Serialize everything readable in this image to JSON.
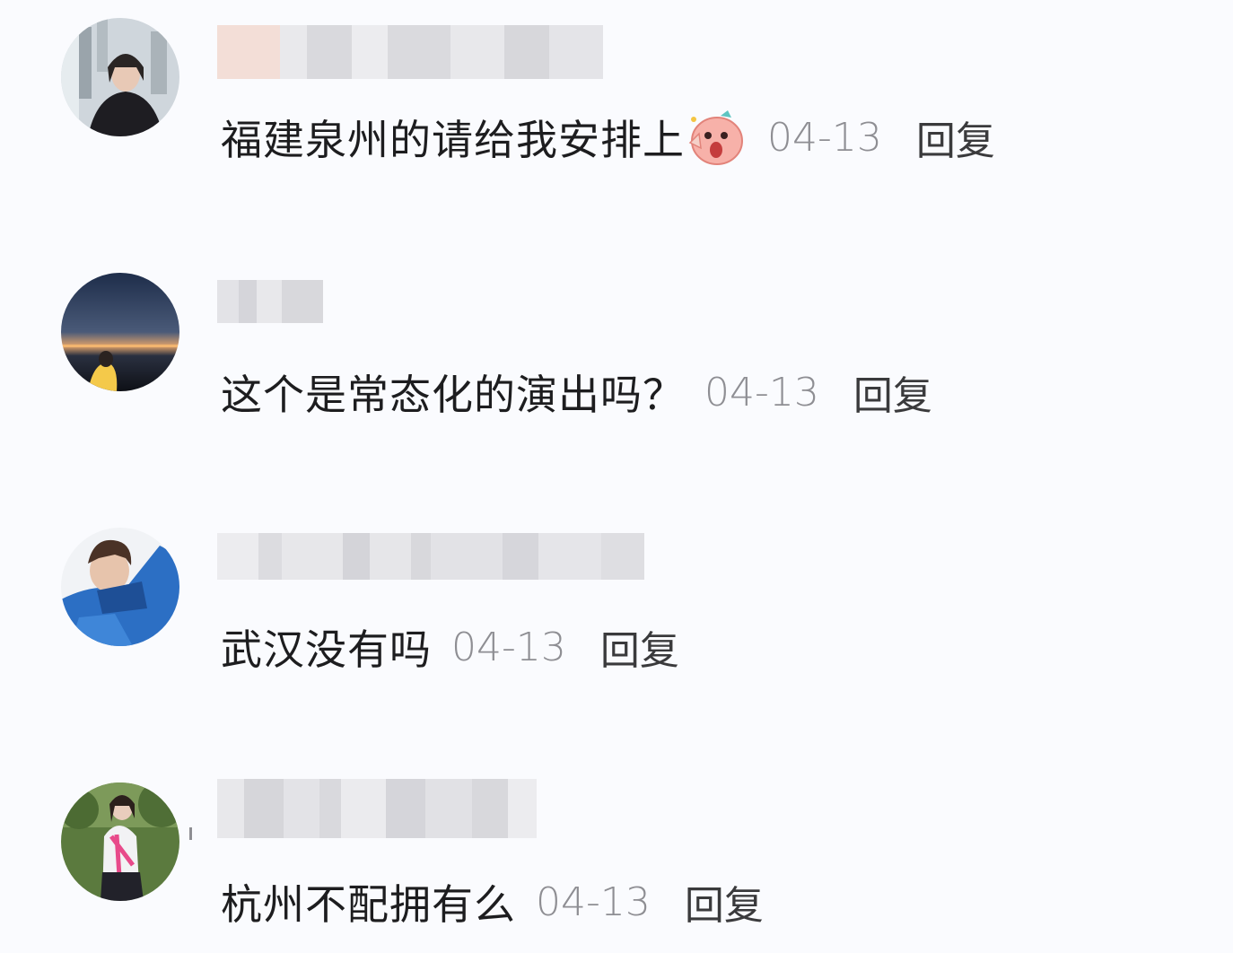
{
  "comments": [
    {
      "text": "福建泉州的请给我安排上",
      "emoji": "shocked-face-emoji",
      "date": "04-13",
      "reply": "回复"
    },
    {
      "text": "这个是常态化的演出吗？",
      "date": "04-13",
      "reply": "回复"
    },
    {
      "text": "武汉没有吗",
      "date": "04-13",
      "reply": "回复"
    },
    {
      "text": "杭州不配拥有么",
      "date": "04-13",
      "reply": "回复"
    }
  ],
  "colors": {
    "background": "#fafbfe",
    "text": "#1d1d1f",
    "meta": "#8e8e93",
    "blur": "#dcdce0"
  }
}
